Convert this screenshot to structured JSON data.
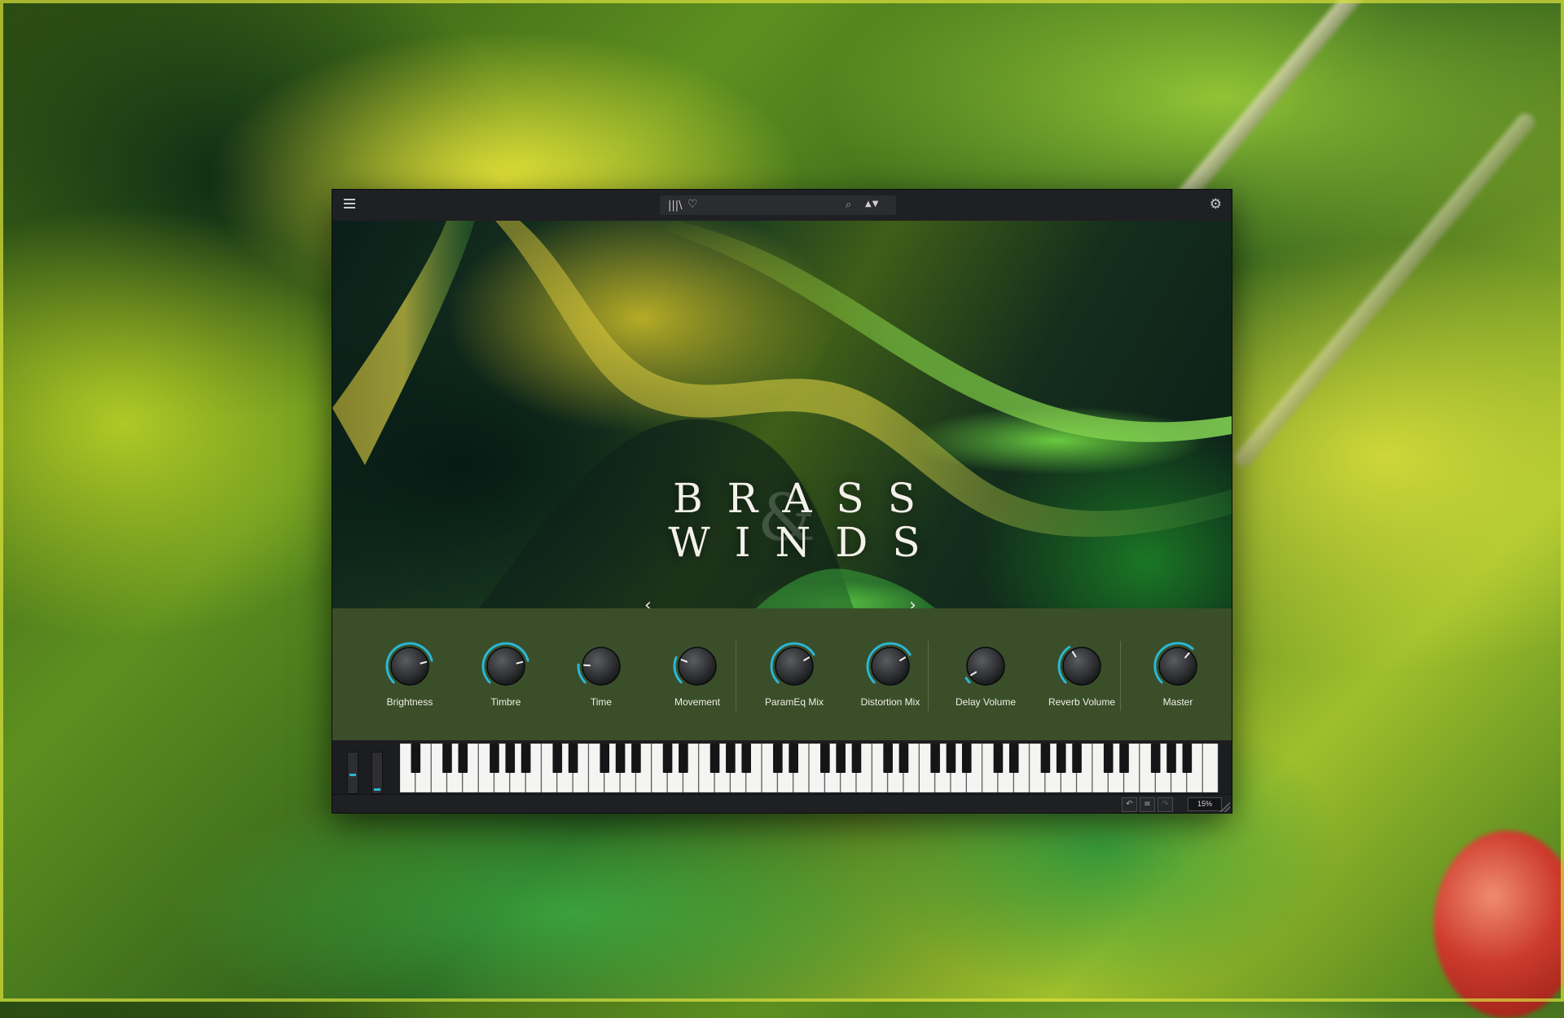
{
  "window": {
    "title_line_1": "BRASS",
    "title_line_2": "WINDS",
    "ampersand": "&"
  },
  "topbar": {
    "menu_icon": "hamburger-menu-icon",
    "library_icon": "library-icon",
    "favorite_icon": "heart-icon",
    "preset_name": "",
    "search_icon": "search-icon",
    "nav_arrows": "▲▼",
    "settings_icon": "gear-icon"
  },
  "artwork_nav": {
    "prev": "‹",
    "next": "›"
  },
  "knobs": [
    {
      "label": "Brightness",
      "value": 0.78
    },
    {
      "label": "Timbre",
      "value": 0.78
    },
    {
      "label": "Time",
      "value": 0.18
    },
    {
      "label": "Movement",
      "value": 0.25
    },
    {
      "label": "ParamEq Mix",
      "value": 0.72
    },
    {
      "label": "Distortion Mix",
      "value": 0.72
    },
    {
      "label": "Delay Volume",
      "value": 0.05
    },
    {
      "label": "Reverb Volume",
      "value": 0.38
    },
    {
      "label": "Master",
      "value": 0.65
    }
  ],
  "wheels": {
    "pitch_value": 0.45,
    "mod_value": 0.05
  },
  "keyboard": {
    "white_keys": 52
  },
  "statusbar": {
    "undo_icon": "undo-icon",
    "history_icon": "history-list-icon",
    "redo_icon": "redo-icon",
    "cpu": "15%"
  },
  "colors": {
    "accent": "#2ab7d6",
    "panel": "#3c522a",
    "chrome": "#1f2023"
  }
}
